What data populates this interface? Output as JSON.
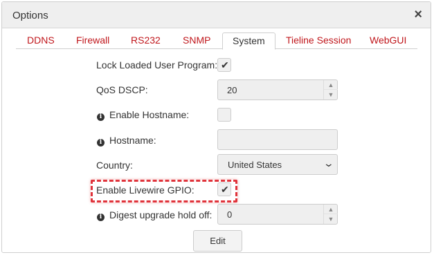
{
  "dialog": {
    "title": "Options",
    "close_icon": "×"
  },
  "tabs": [
    {
      "label": "DDNS",
      "active": false
    },
    {
      "label": "Firewall",
      "active": false
    },
    {
      "label": "RS232",
      "active": false
    },
    {
      "label": "SNMP",
      "active": false
    },
    {
      "label": "System",
      "active": true
    },
    {
      "label": "Tieline Session",
      "active": false
    },
    {
      "label": "WebGUI",
      "active": false
    }
  ],
  "form": {
    "lock_loaded_user_program": {
      "label": "Lock Loaded User Program:",
      "checked": true
    },
    "qos_dscp": {
      "label": "QoS DSCP:",
      "value": "20"
    },
    "enable_hostname": {
      "label": "Enable Hostname:",
      "checked": false
    },
    "hostname": {
      "label": "Hostname:",
      "value": ""
    },
    "country": {
      "label": "Country:",
      "value": "United States"
    },
    "enable_livewire_gpio": {
      "label": "Enable Livewire GPIO:",
      "checked": true
    },
    "digest_upgrade_hold_off": {
      "label": "Digest upgrade hold off:",
      "value": "0"
    }
  },
  "icons": {
    "check": "✔",
    "info": "i",
    "spin_up": "▲",
    "spin_down": "▼",
    "dropdown": "⌄"
  },
  "buttons": {
    "edit_label": "Edit"
  },
  "colors": {
    "tab_link": "#c0161b",
    "highlight": "#e0333b"
  }
}
